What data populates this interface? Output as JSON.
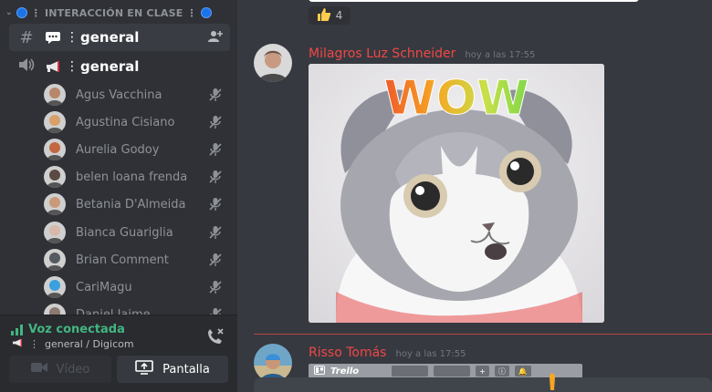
{
  "sidebar": {
    "category": "INTERACCIÓN EN CLASE",
    "channels": [
      {
        "icon": "hash-icon",
        "emoji": "speech-bubble-icon",
        "name": "general",
        "selected": true
      },
      {
        "icon": "speaker-icon",
        "emoji": "megaphone-icon",
        "name": "general",
        "selected": false
      }
    ],
    "members": [
      {
        "name": "Agus Vacchina",
        "avatar_color": "#b8866b"
      },
      {
        "name": "Agustina Cisiano",
        "avatar_color": "#d9a06a"
      },
      {
        "name": "Aurelia Godoy",
        "avatar_color": "#c2683e"
      },
      {
        "name": "belen loana frenda",
        "avatar_color": "#5a4a44"
      },
      {
        "name": "Betania D'Almeida",
        "avatar_color": "#c99a7a"
      },
      {
        "name": "Bianca Guariglia",
        "avatar_color": "#d8b8a8"
      },
      {
        "name": "Brian Comment",
        "avatar_color": "#555a60"
      },
      {
        "name": "CariMagu",
        "avatar_color": "#3aa0e0"
      },
      {
        "name": "Daniel Jaime",
        "avatar_color": "#8a7a70"
      }
    ],
    "voice": {
      "status": "Voz conectada",
      "location": "general / Digicom"
    },
    "buttons": {
      "video": "Vídeo",
      "screen": "Pantalla"
    }
  },
  "chat": {
    "reaction": {
      "emoji": "thumbs-up-icon",
      "count": "4"
    },
    "messages": [
      {
        "author": "Milagros Luz Schneider",
        "time": "hoy a las 17:55",
        "gif_text": "WOW"
      },
      {
        "author": "Risso Tomás",
        "time": "hoy a las 17:55",
        "embed_label": "Trello"
      }
    ]
  },
  "colors": {
    "sidebar_bg": "#2f3136",
    "chat_bg": "#36393f",
    "voice_green": "#43b581",
    "author_red": "#f04747"
  }
}
